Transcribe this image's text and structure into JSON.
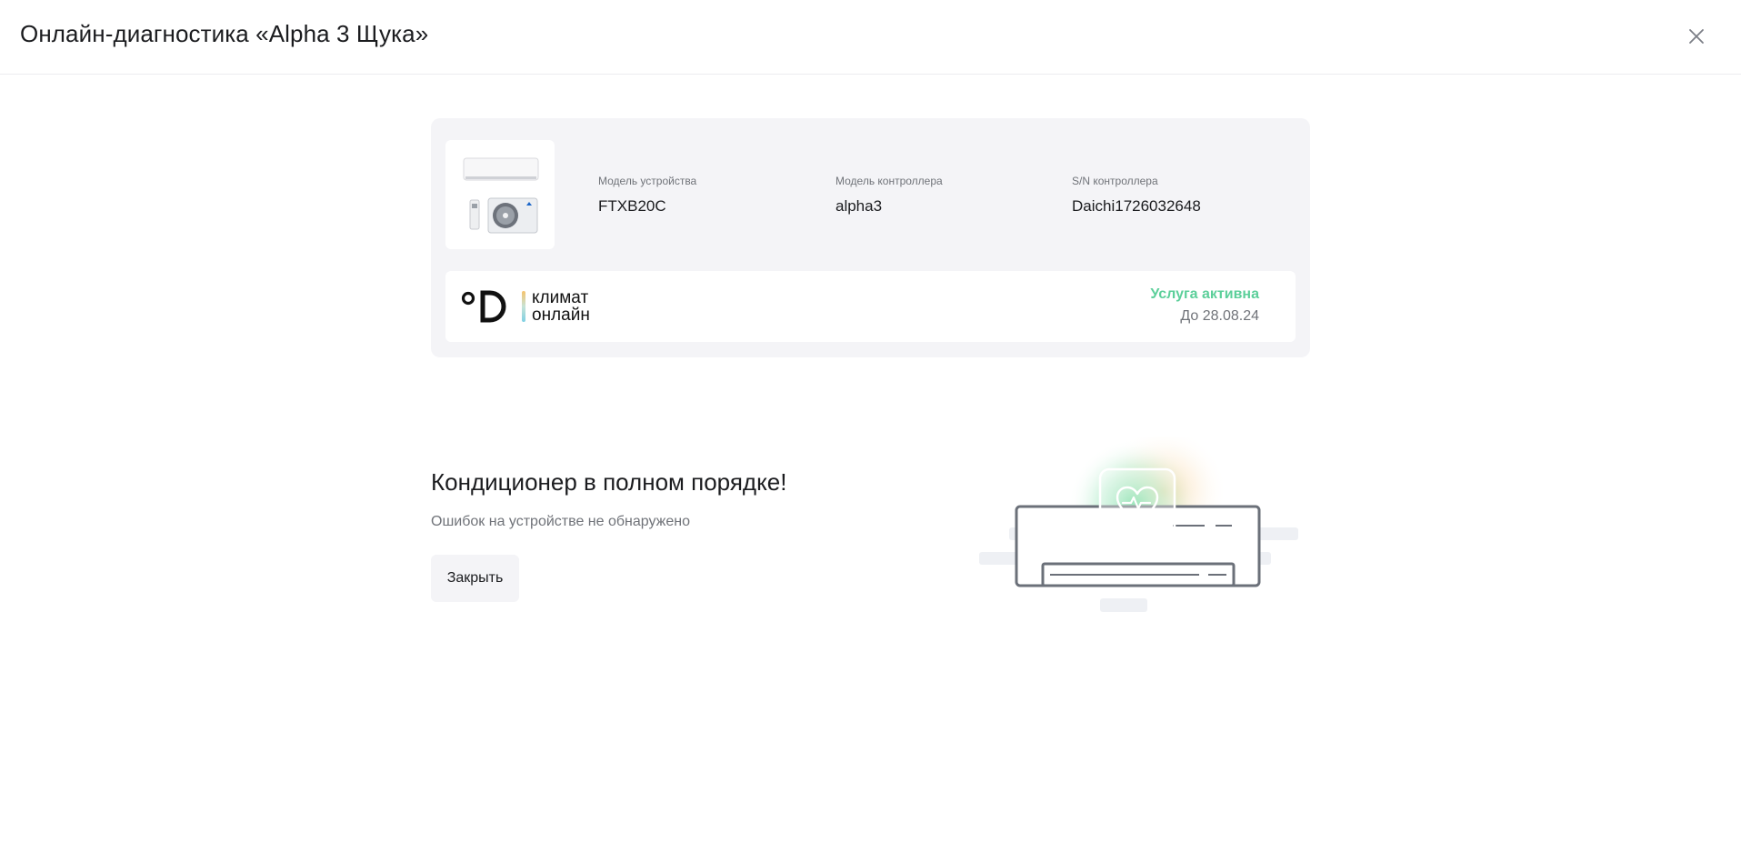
{
  "header": {
    "title": "Онлайн-диагностика «Alpha 3 Щука»"
  },
  "device": {
    "fields": [
      {
        "label": "Модель устройства",
        "value": "FTXB20C"
      },
      {
        "label": "Модель контроллера",
        "value": "alpha3"
      },
      {
        "label": "S/N контроллера",
        "value": "Daichi1726032648"
      }
    ]
  },
  "service": {
    "logo_line1": "климат",
    "logo_line2": "онлайн",
    "status": "Услуга активна",
    "until": "До 28.08.24",
    "status_color": "#5ccf9a"
  },
  "result": {
    "title": "Кондиционер в полном порядке!",
    "subtitle": "Ошибок на устройстве не обнаружено",
    "close_label": "Закрыть"
  },
  "icons": {
    "close": "close-icon",
    "heart": "heart-pulse-icon"
  }
}
